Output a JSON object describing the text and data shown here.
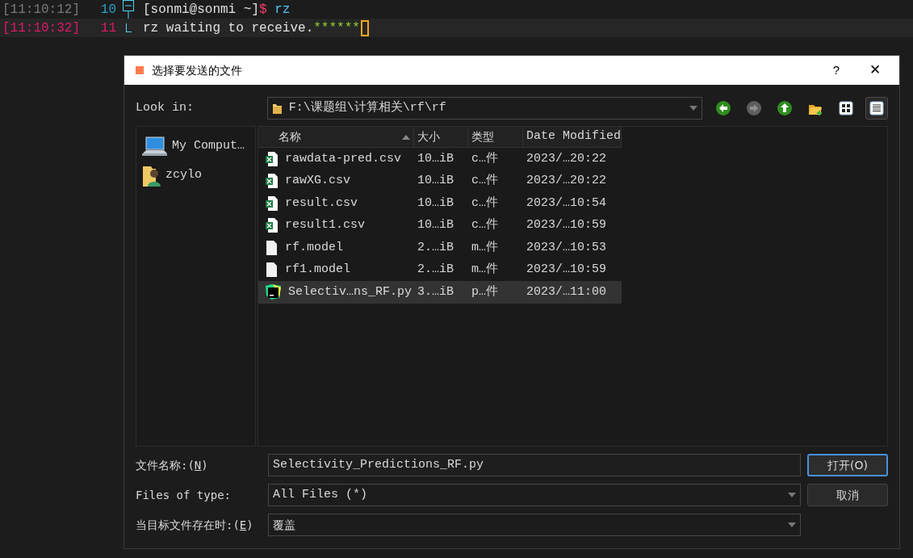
{
  "terminal": {
    "lines": [
      {
        "time": "[11:10:12]",
        "number": "10",
        "current": false,
        "kind": "fold-start",
        "segments": [
          {
            "text": "[sonmi@sonmi ~]",
            "color": "#e0e0e0"
          },
          {
            "text": "$",
            "color": "#ff3b6b"
          },
          {
            "text": " rz",
            "color": "#4fc3f7"
          }
        ],
        "cursor": false
      },
      {
        "time": "[11:10:32]",
        "number": "11",
        "current": true,
        "kind": "fold-end",
        "segments": [
          {
            "text": "rz waiting to receive.",
            "color": "#e0e0e0"
          },
          {
            "text": "******",
            "color": "#9acd32"
          }
        ],
        "cursor": true
      }
    ]
  },
  "dialog": {
    "title": "选择要发送的文件",
    "help": "?",
    "close": "✕",
    "look_in": {
      "label": "Look in:",
      "path": "F:\\课题组\\计算相关\\rf\\rf"
    },
    "toolbar": [
      {
        "kind": "back",
        "disabled": false
      },
      {
        "kind": "forward",
        "disabled": true
      },
      {
        "kind": "up",
        "disabled": false
      },
      {
        "kind": "new-folder",
        "disabled": false
      },
      {
        "kind": "icon-view",
        "selected": false
      },
      {
        "kind": "detail-view",
        "selected": true
      }
    ],
    "sidebar": {
      "items": [
        {
          "kind": "computer",
          "label": "My Comput…"
        },
        {
          "kind": "user",
          "label": "zcylo"
        }
      ]
    },
    "table": {
      "columns": [
        {
          "label": "名称",
          "sorted": true
        },
        {
          "label": "大小",
          "sorted": false
        },
        {
          "label": "类型",
          "sorted": false
        },
        {
          "label": "Date Modified",
          "sorted": false
        }
      ],
      "rows": [
        {
          "kind": "excel",
          "name": "rawdata-pred.csv",
          "size": "10…iB",
          "type": "c…件",
          "date": "2023/…20:22",
          "selected": false
        },
        {
          "kind": "excel",
          "name": "rawXG.csv",
          "size": "10…iB",
          "type": "c…件",
          "date": "2023/…20:22",
          "selected": false
        },
        {
          "kind": "excel",
          "name": "result.csv",
          "size": "10…iB",
          "type": "c…件",
          "date": "2023/…10:54",
          "selected": false
        },
        {
          "kind": "excel",
          "name": "result1.csv",
          "size": "10…iB",
          "type": "c…件",
          "date": "2023/…10:59",
          "selected": false
        },
        {
          "kind": "blank",
          "name": "rf.model",
          "size": "2.…iB",
          "type": "m…件",
          "date": "2023/…10:53",
          "selected": false
        },
        {
          "kind": "blank",
          "name": "rf1.model",
          "size": "2.…iB",
          "type": "m…件",
          "date": "2023/…10:59",
          "selected": false
        },
        {
          "kind": "pycharm",
          "name": "Selectiv…ns_RF.py",
          "size": "3.…iB",
          "type": "p…件",
          "date": "2023/…11:00",
          "selected": true
        }
      ]
    },
    "fields": [
      {
        "kind": "text",
        "label_before": "文件名称:(",
        "mnemonic": "N",
        "label_after": ")",
        "value": "Selectivity_Predictions_RF.py",
        "button": "打开(O)",
        "default": true
      },
      {
        "kind": "combo",
        "label_before": "Files of type:",
        "value": "All Files (*)",
        "button": "取消",
        "default": false
      },
      {
        "kind": "combo",
        "label_before": "当目标文件存在时:(",
        "mnemonic": "E",
        "label_after": ")",
        "value": "覆盖"
      }
    ]
  }
}
